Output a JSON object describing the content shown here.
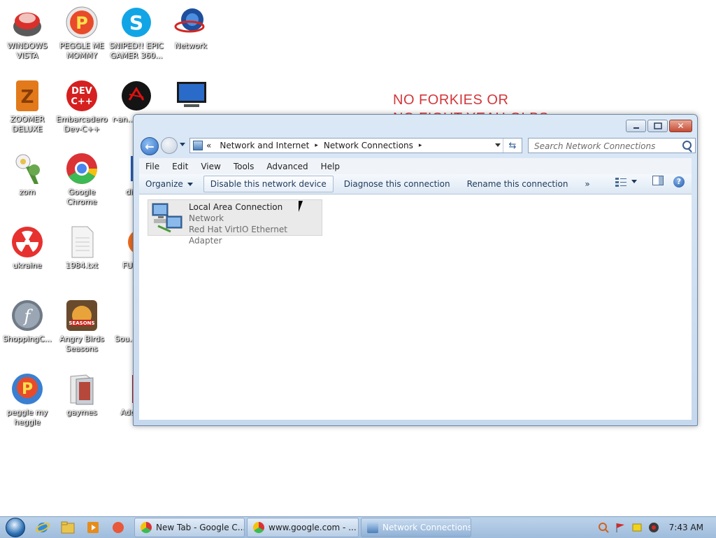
{
  "desktop": {
    "icons": [
      {
        "label": "WINDOWS VISTA"
      },
      {
        "label": "PEGGLE ME MOMMY"
      },
      {
        "label": "SNIPED!! EPIC GAMER 360..."
      },
      {
        "label": "Network"
      },
      {
        "label": "ZOOMER DELUXE"
      },
      {
        "label": "Embarcadero Dev-C++"
      },
      {
        "label": "r-an... part..."
      },
      {
        "label": "zom"
      },
      {
        "label": "Google Chrome"
      },
      {
        "label": "digi..."
      },
      {
        "label": "ukraine"
      },
      {
        "label": "1984.txt"
      },
      {
        "label": "FURR..."
      },
      {
        "label": "ShoppingC..."
      },
      {
        "label": "Angry Birds Seasons"
      },
      {
        "label": "Sou... Pla..."
      },
      {
        "label": "peggle my heggle"
      },
      {
        "label": "gaymes"
      },
      {
        "label": "Adobe..."
      }
    ],
    "wallpaper_text_line1": "NO FORKIES OR",
    "wallpaper_text_line2": "NO FIGHT YEAH GLBS"
  },
  "window": {
    "title_buttons": {
      "minimize": "—",
      "maximize": "▫",
      "close": "✕"
    },
    "breadcrumb": {
      "prefix": "«",
      "items": [
        "Network and Internet",
        "Network Connections"
      ],
      "separator": "▸"
    },
    "search_placeholder": "Search Network Connections",
    "menu": [
      "File",
      "Edit",
      "View",
      "Tools",
      "Advanced",
      "Help"
    ],
    "commands": {
      "organize": "Organize",
      "disable": "Disable this network device",
      "diagnose": "Diagnose this connection",
      "rename": "Rename this connection",
      "more": "»"
    },
    "help_label": "?",
    "connection": {
      "name": "Local Area Connection",
      "network": "Network",
      "adapter": "Red Hat VirtIO Ethernet Adapter"
    }
  },
  "taskbar": {
    "tasks": [
      {
        "label": "New Tab - Google C..."
      },
      {
        "label": "www.google.com - ..."
      },
      {
        "label": "Network Connections"
      }
    ],
    "clock": "7:43 AM"
  },
  "colors": {
    "wallpaper_text": "#d2373b",
    "accent": "#2d6bc3"
  }
}
